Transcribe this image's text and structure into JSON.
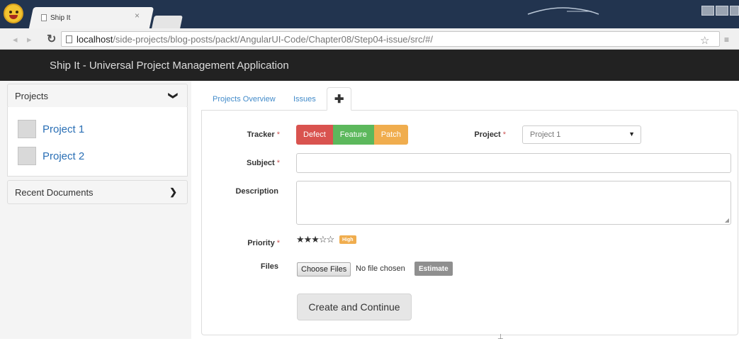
{
  "browser": {
    "tab_title": "Ship It",
    "tab_close": "×",
    "url_host": "localhost",
    "url_path": "/side-projects/blog-posts/packt/AngularUI-Code/Chapter08/Step04-issue/src/#/",
    "icons": [
      "smiley-avatar-icon",
      "page-icon",
      "back-icon",
      "forward-icon",
      "reload-icon",
      "star-icon",
      "menu-icon"
    ]
  },
  "navbar": {
    "brand": "Ship It - Universal Project Management Application"
  },
  "sidebar": {
    "projects_header": "Projects",
    "projects": [
      {
        "name": "Project 1"
      },
      {
        "name": "Project 2"
      }
    ],
    "recent_header": "Recent Documents"
  },
  "tabs": {
    "overview": "Projects Overview",
    "issues": "Issues",
    "add": "✚"
  },
  "form": {
    "required_mark": "*",
    "tracker_label": "Tracker",
    "tracker_options": [
      "Defect",
      "Feature",
      "Patch"
    ],
    "project_label": "Project",
    "project_value": "Project 1",
    "subject_label": "Subject",
    "description_label": "Description",
    "priority_label": "Priority",
    "priority_stars": "★★★☆☆",
    "priority_rating": 3,
    "priority_max": 5,
    "priority_badge": "High",
    "files_label": "Files",
    "choose_files": "Choose Files",
    "file_status": "No file chosen",
    "estimate": "Estimate",
    "submit": "Create and Continue"
  },
  "colors": {
    "defect": "#d9534f",
    "feature": "#5cb85c",
    "patch": "#f0ad4e",
    "link": "#2a6fb5",
    "navbar": "#222222"
  }
}
